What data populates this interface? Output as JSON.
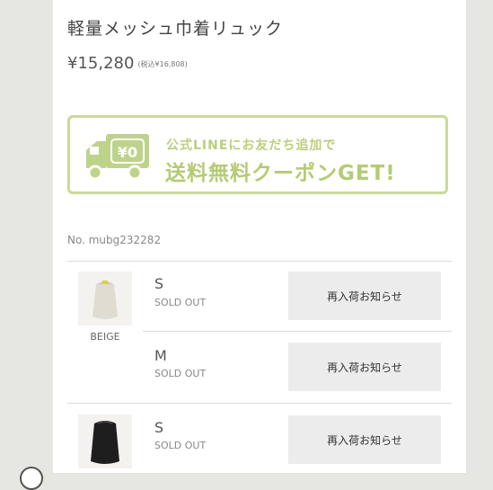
{
  "product": {
    "title": "軽量メッシュ巾着リュック",
    "price": "¥15,280",
    "price_tax": "(税込¥16,808)",
    "number": "No. mubg232282"
  },
  "banner": {
    "badge": "¥0",
    "line1": "公式LINEにお友だち追加で",
    "line2": "送料無料クーポンGET!",
    "color": "#c9da9c"
  },
  "variants": [
    {
      "color": "BEIGE",
      "sizes": [
        {
          "size": "S",
          "status": "SOLD OUT",
          "button": "再入荷お知らせ"
        },
        {
          "size": "M",
          "status": "SOLD OUT",
          "button": "再入荷お知らせ"
        }
      ]
    },
    {
      "color": "",
      "sizes": [
        {
          "size": "S",
          "status": "SOLD OUT",
          "button": "再入荷お知らせ"
        }
      ]
    }
  ]
}
